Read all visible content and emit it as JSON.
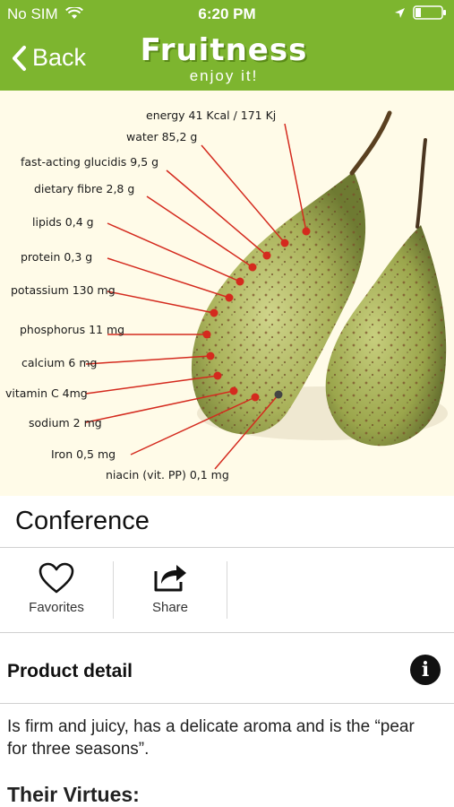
{
  "status_bar": {
    "carrier": "No SIM",
    "time": "6:20 PM"
  },
  "nav": {
    "back_label": "Back",
    "logo_text": "Fruitness",
    "logo_tagline": "enjoy it!"
  },
  "hero": {
    "nutrients": [
      "energy  41 Kcal / 171 Kj",
      "water 85,2 g",
      "fast-acting glucidis  9,5 g",
      "dietary fibre  2,8 g",
      "lipids 0,4 g",
      "protein  0,3 g",
      "potassium  130 mg",
      "phosphorus 11 mg",
      "calcium  6 mg",
      "vitamin  C 4mg",
      "sodium 2 mg",
      "Iron 0,5 mg",
      "niacin  (vit. PP) 0,1 mg"
    ]
  },
  "product": {
    "name": "Conference"
  },
  "actions": {
    "favorites": "Favorites",
    "share": "Share"
  },
  "detail": {
    "heading": "Product detail",
    "info_icon_glyph": "i",
    "description": "Is firm and juicy, has a delicate aroma and is the “pear for three seasons”.",
    "virtues_heading": "Their Virtues:"
  },
  "colors": {
    "brand_green": "#7db52f",
    "leader_red": "#d42a1e",
    "hero_bg": "#fffbe8"
  }
}
